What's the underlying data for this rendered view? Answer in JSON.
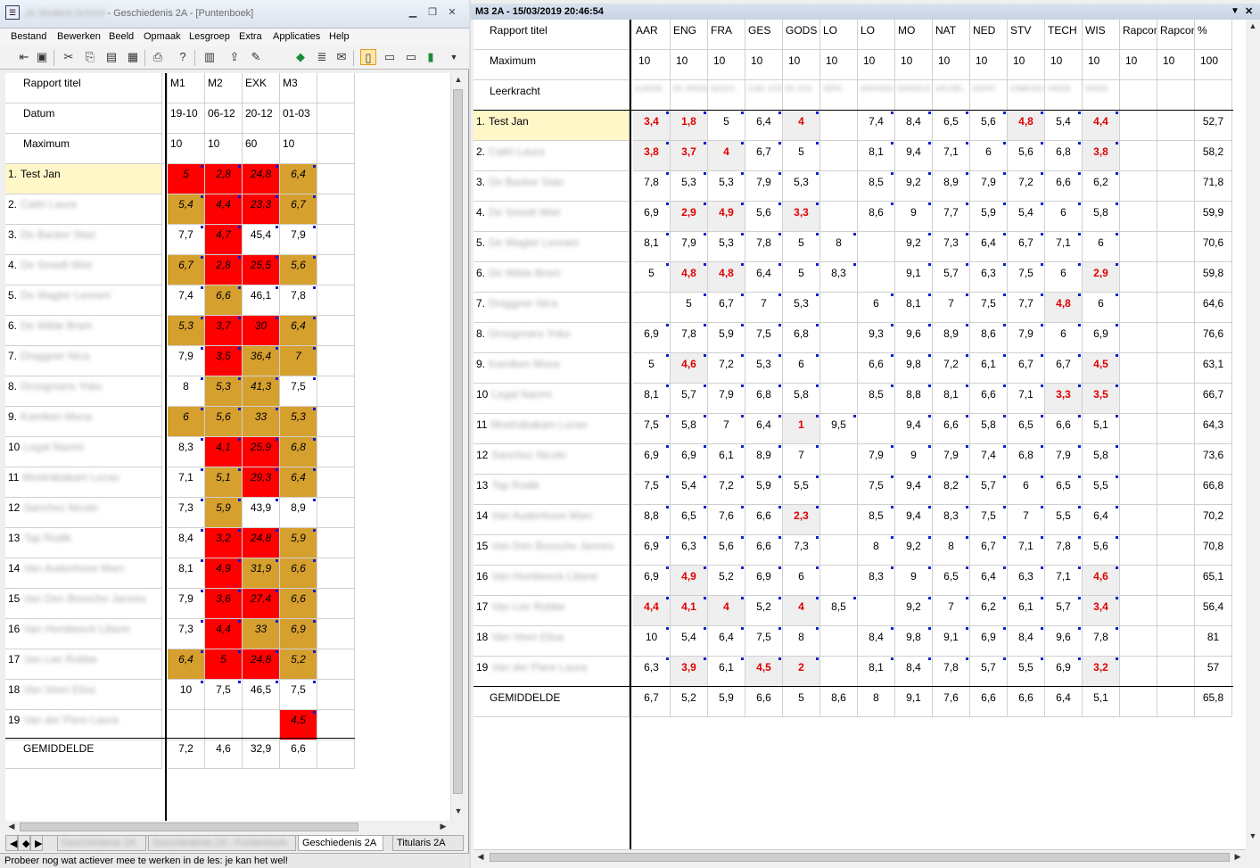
{
  "left_window": {
    "title": "Geschiedenis 2A - [Puntenboek]",
    "blurred_prefix": "Jo Student School",
    "menu": [
      "Bestand",
      "Bewerken",
      "Beeld",
      "Opmaak",
      "Lesgroep",
      "Extra",
      "Applicaties",
      "Help"
    ],
    "toolbar_icons": [
      "import-icon",
      "save-icon",
      "cut-icon",
      "copy-icon",
      "paste-icon",
      "paste-special-icon",
      "print-icon",
      "help-icon",
      "calendar-icon",
      "export-icon",
      "tools-icon",
      "eraser-icon",
      "report-icon",
      "notes-icon",
      "view-mode-1-icon",
      "view-mode-2-icon",
      "view-mode-3-icon",
      "view-mode-4-icon"
    ],
    "header_rows": {
      "titel_label": "Rapport titel",
      "datum_label": "Datum",
      "max_label": "Maximum",
      "cols": [
        "M1",
        "M2",
        "EXK",
        "M3"
      ],
      "dates": [
        "19-10",
        "06-12",
        "20-12",
        "01-03"
      ],
      "maximum": [
        "10",
        "10",
        "60",
        "10"
      ]
    },
    "students": [
      {
        "num": "1.",
        "name": "Test Jan",
        "blur": false
      },
      {
        "num": "2.",
        "name": "Cattri Laura",
        "blur": true
      },
      {
        "num": "3.",
        "name": "De Backer Stan",
        "blur": true
      },
      {
        "num": "4.",
        "name": "De Smedt Wiel",
        "blur": true
      },
      {
        "num": "5.",
        "name": "De Wagter Lennert",
        "blur": true
      },
      {
        "num": "6.",
        "name": "De Wilde Bram",
        "blur": true
      },
      {
        "num": "7.",
        "name": "Draggner Nica",
        "blur": true
      },
      {
        "num": "8.",
        "name": "Droogmans Yoko",
        "blur": true
      },
      {
        "num": "9.",
        "name": "Kamiken Mona",
        "blur": true
      },
      {
        "num": "10",
        "name": "Legal Naomi",
        "blur": true
      },
      {
        "num": "11",
        "name": "Mostrabakam Lucas",
        "blur": true
      },
      {
        "num": "12",
        "name": "Sanchez Nicolo",
        "blur": true
      },
      {
        "num": "13",
        "name": "Tap Rodik",
        "blur": true
      },
      {
        "num": "14",
        "name": "Van Audenhove Marc",
        "blur": true
      },
      {
        "num": "15",
        "name": "Van Den Bossche Jannes",
        "blur": true
      },
      {
        "num": "16",
        "name": "Van Hombeeck Liliane",
        "blur": true
      },
      {
        "num": "17",
        "name": "Van Lier Robbe",
        "blur": true
      },
      {
        "num": "18",
        "name": "Van Veen Elisa",
        "blur": true
      },
      {
        "num": "19",
        "name": "Van der Piere Laura",
        "blur": true
      }
    ],
    "scores": [
      [
        "5",
        "2,8",
        "24,8",
        "6,4"
      ],
      [
        "5,4",
        "4,4",
        "23,3",
        "6,7"
      ],
      [
        "7,7",
        "4,7",
        "45,4",
        "7,9"
      ],
      [
        "6,7",
        "2,8",
        "25,5",
        "5,6"
      ],
      [
        "7,4",
        "6,6",
        "46,1",
        "7,8"
      ],
      [
        "5,3",
        "3,7",
        "30",
        "6,4"
      ],
      [
        "7,9",
        "3,5",
        "36,4",
        "7"
      ],
      [
        "8",
        "5,3",
        "41,3",
        "7,5"
      ],
      [
        "6",
        "5,6",
        "33",
        "5,3"
      ],
      [
        "8,3",
        "4,1",
        "25,9",
        "6,8"
      ],
      [
        "7,1",
        "5,1",
        "29,3",
        "6,4"
      ],
      [
        "7,3",
        "5,9",
        "43,9",
        "8,9"
      ],
      [
        "8,4",
        "3,2",
        "24,8",
        "5,9"
      ],
      [
        "8,1",
        "4,9",
        "31,9",
        "6,6"
      ],
      [
        "7,9",
        "3,6",
        "27,4",
        "6,6"
      ],
      [
        "7,3",
        "4,4",
        "33",
        "6,9"
      ],
      [
        "6,4",
        "5",
        "24,8",
        "5,2"
      ],
      [
        "10",
        "7,5",
        "46,5",
        "7,5"
      ],
      [
        "",
        "",
        "",
        "4,5"
      ]
    ],
    "score_colors": [
      [
        "red",
        "red",
        "red",
        "orange"
      ],
      [
        "orange",
        "red",
        "red",
        "orange"
      ],
      [
        "",
        "red",
        "",
        ""
      ],
      [
        "orange",
        "red",
        "red",
        "orange"
      ],
      [
        "",
        "orange",
        "",
        ""
      ],
      [
        "orange",
        "red",
        "red",
        "orange"
      ],
      [
        "",
        "red",
        "orange",
        "orange"
      ],
      [
        "",
        "orange",
        "orange",
        ""
      ],
      [
        "orange",
        "orange",
        "orange",
        "orange"
      ],
      [
        "",
        "red",
        "red",
        "orange"
      ],
      [
        "",
        "orange",
        "red",
        "orange"
      ],
      [
        "",
        "orange",
        "",
        ""
      ],
      [
        "",
        "red",
        "red",
        "orange"
      ],
      [
        "",
        "red",
        "orange",
        "orange"
      ],
      [
        "",
        "red",
        "red",
        "orange"
      ],
      [
        "",
        "red",
        "orange",
        "orange"
      ],
      [
        "orange",
        "red",
        "red",
        "orange"
      ],
      [
        "",
        "",
        "",
        ""
      ],
      [
        "",
        "",
        "",
        "red"
      ]
    ],
    "average_label": "GEMIDDELDE",
    "averages": [
      "7,2",
      "4,6",
      "32,9",
      "6,6"
    ],
    "tabs": [
      "Geschiedenis 2A",
      "Geschiedenis 2A - Puntenboek",
      "Geschiedenis 2A",
      "Titularis 2A"
    ],
    "tab_blur": [
      true,
      true,
      false,
      false
    ],
    "status_text": "Probeer nog wat actiever mee te werken in de les: je kan het wel!"
  },
  "right_window": {
    "title": "M3 2A   - 15/03/2019 20:46:54",
    "header_labels": [
      "Rapport titel",
      "Maximum",
      "Leerkracht"
    ],
    "subjects": [
      "AAR",
      "ENG",
      "FRA",
      "GES",
      "GODS",
      "LO",
      "LO",
      "MO",
      "NAT",
      "NED",
      "STV",
      "TECH",
      "WIS",
      "Rapcom",
      "Rapcom",
      "%"
    ],
    "maximum": [
      "10",
      "10",
      "10",
      "10",
      "10",
      "10",
      "10",
      "10",
      "10",
      "10",
      "10",
      "10",
      "10",
      "10",
      "10",
      "100"
    ],
    "teachers": [
      "AJANSE",
      "DE VRIENDE",
      "GESCH",
      "COM, STEVEN",
      "DE VOS",
      "VERH",
      "VERHAEG",
      "SANGELE",
      "VAN BEL",
      "GEERT",
      "VDBROECKE",
      "VANDE",
      "VANDE"
    ],
    "students": [
      {
        "num": "1.",
        "name": "Test Jan",
        "blur": false
      },
      {
        "num": "2.",
        "name": "Cattri Laura",
        "blur": true
      },
      {
        "num": "3.",
        "name": "De Backer Stan",
        "blur": true
      },
      {
        "num": "4.",
        "name": "De Smedt Wiel",
        "blur": true
      },
      {
        "num": "5.",
        "name": "De Wagter Lennert",
        "blur": true
      },
      {
        "num": "6.",
        "name": "De Wilde Bram",
        "blur": true
      },
      {
        "num": "7.",
        "name": "Draggner Nica",
        "blur": true
      },
      {
        "num": "8.",
        "name": "Droogmans Yoko",
        "blur": true
      },
      {
        "num": "9.",
        "name": "Kamiken Mona",
        "blur": true
      },
      {
        "num": "10",
        "name": "Legal Naomi",
        "blur": true
      },
      {
        "num": "11",
        "name": "Mostrabakam Lucas",
        "blur": true
      },
      {
        "num": "12",
        "name": "Sanchez Nicolo",
        "blur": true
      },
      {
        "num": "13",
        "name": "Tap Rodik",
        "blur": true
      },
      {
        "num": "14",
        "name": "Van Audenhove Marc",
        "blur": true
      },
      {
        "num": "15",
        "name": "Van Den Bossche Jannes",
        "blur": true
      },
      {
        "num": "16",
        "name": "Van Hombeeck Liliane",
        "blur": true
      },
      {
        "num": "17",
        "name": "Van Lier Robbe",
        "blur": true
      },
      {
        "num": "18",
        "name": "Van Veen Elisa",
        "blur": true
      },
      {
        "num": "19",
        "name": "Van der Piere Laura",
        "blur": true
      }
    ],
    "scores": [
      [
        "3,4",
        "1,8",
        "5",
        "6,4",
        "4",
        "",
        "7,4",
        "8,4",
        "6,5",
        "5,6",
        "4,8",
        "5,4",
        "4,4",
        "",
        "",
        "52,7"
      ],
      [
        "3,8",
        "3,7",
        "4",
        "6,7",
        "5",
        "",
        "8,1",
        "9,4",
        "7,1",
        "6",
        "5,6",
        "6,8",
        "3,8",
        "",
        "",
        "58,2"
      ],
      [
        "7,8",
        "5,3",
        "5,3",
        "7,9",
        "5,3",
        "",
        "8,5",
        "9,2",
        "8,9",
        "7,9",
        "7,2",
        "6,6",
        "6,2",
        "",
        "",
        "71,8"
      ],
      [
        "6,9",
        "2,9",
        "4,9",
        "5,6",
        "3,3",
        "",
        "8,6",
        "9",
        "7,7",
        "5,9",
        "5,4",
        "6",
        "5,8",
        "",
        "",
        "59,9"
      ],
      [
        "8,1",
        "7,9",
        "5,3",
        "7,8",
        "5",
        "8",
        "",
        "9,2",
        "7,3",
        "6,4",
        "6,7",
        "7,1",
        "6",
        "",
        "",
        "70,6"
      ],
      [
        "5",
        "4,8",
        "4,8",
        "6,4",
        "5",
        "8,3",
        "",
        "9,1",
        "5,7",
        "6,3",
        "7,5",
        "6",
        "2,9",
        "",
        "",
        "59,8"
      ],
      [
        "",
        "5",
        "6,7",
        "7",
        "5,3",
        "",
        "6",
        "8,1",
        "7",
        "7,5",
        "7,7",
        "4,8",
        "6",
        "",
        "",
        "64,6"
      ],
      [
        "6,9",
        "7,8",
        "5,9",
        "7,5",
        "6,8",
        "",
        "9,3",
        "9,6",
        "8,9",
        "8,6",
        "7,9",
        "6",
        "6,9",
        "",
        "",
        "76,6"
      ],
      [
        "5",
        "4,6",
        "7,2",
        "5,3",
        "6",
        "",
        "6,6",
        "9,8",
        "7,2",
        "6,1",
        "6,7",
        "6,7",
        "4,5",
        "",
        "",
        "63,1"
      ],
      [
        "8,1",
        "5,7",
        "7,9",
        "6,8",
        "5,8",
        "",
        "8,5",
        "8,8",
        "8,1",
        "6,6",
        "7,1",
        "3,3",
        "3,5",
        "",
        "",
        "66,7"
      ],
      [
        "7,5",
        "5,8",
        "7",
        "6,4",
        "1",
        "9,5",
        "",
        "9,4",
        "6,6",
        "5,8",
        "6,5",
        "6,6",
        "5,1",
        "",
        "",
        "64,3"
      ],
      [
        "6,9",
        "6,9",
        "6,1",
        "8,9",
        "7",
        "",
        "7,9",
        "9",
        "7,9",
        "7,4",
        "6,8",
        "7,9",
        "5,8",
        "",
        "",
        "73,6"
      ],
      [
        "7,5",
        "5,4",
        "7,2",
        "5,9",
        "5,5",
        "",
        "7,5",
        "9,4",
        "8,2",
        "5,7",
        "6",
        "6,5",
        "5,5",
        "",
        "",
        "66,8"
      ],
      [
        "8,8",
        "6,5",
        "7,6",
        "6,6",
        "2,3",
        "",
        "8,5",
        "9,4",
        "8,3",
        "7,5",
        "7",
        "5,5",
        "6,4",
        "",
        "",
        "70,2"
      ],
      [
        "6,9",
        "6,3",
        "5,6",
        "6,6",
        "7,3",
        "",
        "8",
        "9,2",
        "8",
        "6,7",
        "7,1",
        "7,8",
        "5,6",
        "",
        "",
        "70,8"
      ],
      [
        "6,9",
        "4,9",
        "5,2",
        "6,9",
        "6",
        "",
        "8,3",
        "9",
        "6,5",
        "6,4",
        "6,3",
        "7,1",
        "4,6",
        "",
        "",
        "65,1"
      ],
      [
        "4,4",
        "4,1",
        "4",
        "5,2",
        "4",
        "8,5",
        "",
        "9,2",
        "7",
        "6,2",
        "6,1",
        "5,7",
        "3,4",
        "",
        "",
        "56,4"
      ],
      [
        "10",
        "5,4",
        "6,4",
        "7,5",
        "8",
        "",
        "8,4",
        "9,8",
        "9,1",
        "6,9",
        "8,4",
        "9,6",
        "7,8",
        "",
        "",
        "81"
      ],
      [
        "6,3",
        "3,9",
        "6,1",
        "4,5",
        "2",
        "",
        "8,1",
        "8,4",
        "7,8",
        "5,7",
        "5,5",
        "6,9",
        "3,2",
        "",
        "",
        "57"
      ]
    ],
    "average_label": "GEMIDDELDE",
    "averages": [
      "6,7",
      "5,2",
      "5,9",
      "6,6",
      "5",
      "8,6",
      "8",
      "9,1",
      "7,6",
      "6,6",
      "6,6",
      "6,4",
      "5,1",
      "",
      "",
      "65,8"
    ]
  }
}
